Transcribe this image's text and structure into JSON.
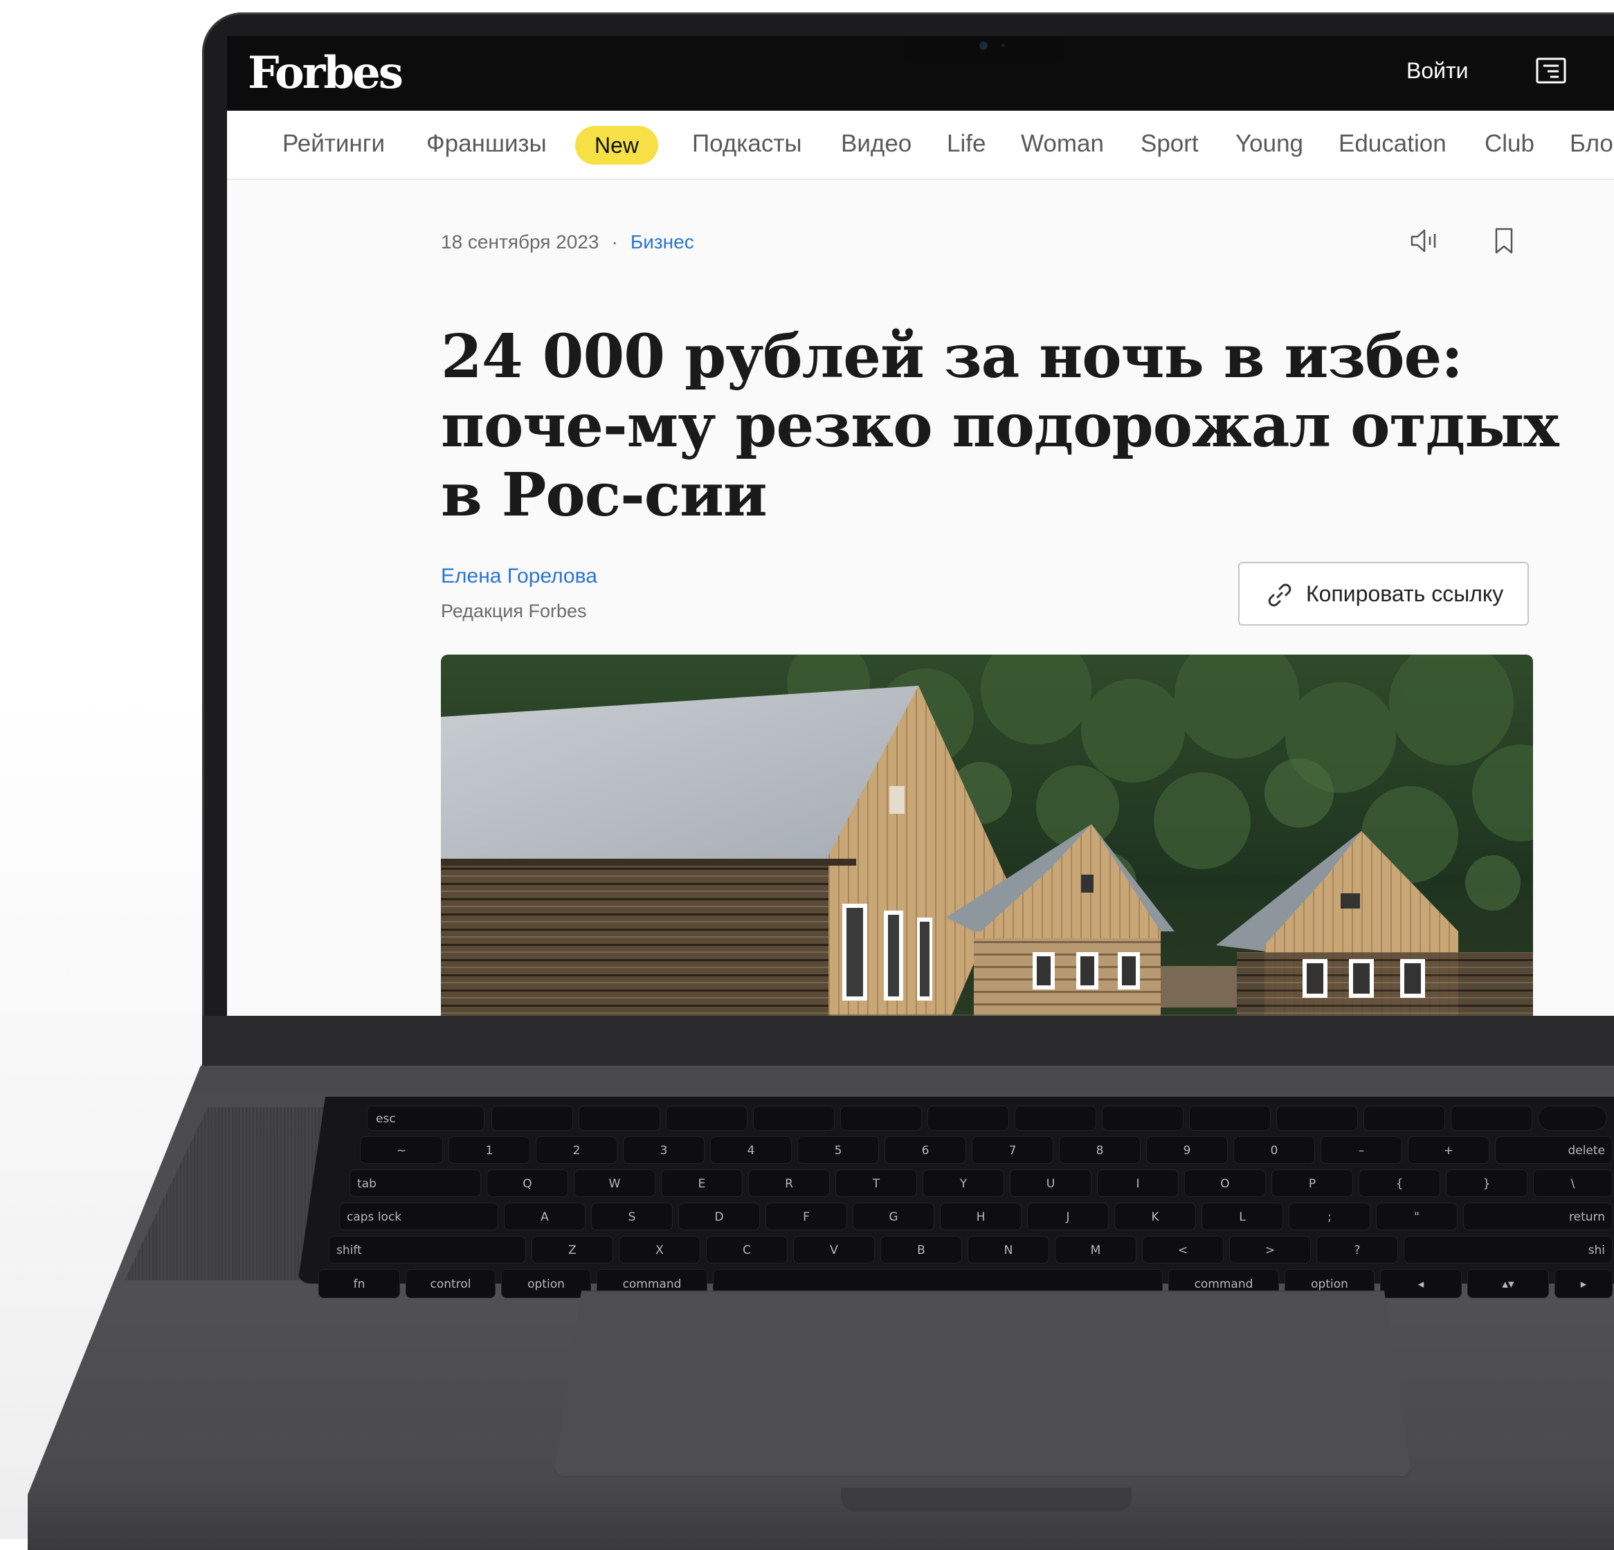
{
  "site": {
    "logo": "Forbes",
    "login_label": "Войти",
    "menu_icon": "menu-icon"
  },
  "nav": {
    "items": [
      {
        "label": "Рейтинги"
      },
      {
        "label": "Франшизы"
      },
      {
        "label": "New",
        "badge": true,
        "badge_color": "#f6e046"
      },
      {
        "label": "Подкасты"
      },
      {
        "label": "Видео"
      },
      {
        "label": "Life"
      },
      {
        "label": "Woman"
      },
      {
        "label": "Sport"
      },
      {
        "label": "Young"
      },
      {
        "label": "Education"
      },
      {
        "label": "Club"
      },
      {
        "label": "Бло"
      }
    ]
  },
  "article": {
    "date": "18 сентября 2023",
    "separator": "·",
    "category": "Бизнес",
    "headline": "24 000 рублей за ночь в избе: поче-му резко подорожал отдых в Рос-сии",
    "author": "Елена Горелова",
    "author_role": "Редакция Forbes",
    "copy_link_label": "Копировать ссылку",
    "listen_icon": "speaker-icon",
    "bookmark_icon": "bookmark-icon",
    "link_icon": "link-icon",
    "photo_alt": "wooden log houses with metal roofs in front of a forest"
  },
  "keyboard": {
    "row_fn": [
      "esc",
      "",
      "",
      "",
      "",
      "",
      "",
      "",
      "",
      "",
      "",
      "",
      ""
    ],
    "row_num": [
      "~",
      "1",
      "2",
      "3",
      "4",
      "5",
      "6",
      "7",
      "8",
      "9",
      "0",
      "–",
      "+",
      "delete"
    ],
    "row_q": [
      "tab",
      "Q",
      "W",
      "E",
      "R",
      "T",
      "Y",
      "U",
      "I",
      "O",
      "P",
      "{",
      "}",
      "\\"
    ],
    "row_a": [
      "caps lock",
      "A",
      "S",
      "D",
      "F",
      "G",
      "H",
      "J",
      "K",
      "L",
      ";",
      "\"",
      "return"
    ],
    "row_z": [
      "shift",
      "Z",
      "X",
      "C",
      "V",
      "B",
      "N",
      "M",
      "<",
      ">",
      "?",
      "shi"
    ],
    "row_bottom": [
      "fn",
      "control",
      "option",
      "command",
      "",
      "command",
      "option",
      "◂",
      "▴▾",
      "▸"
    ]
  },
  "colors": {
    "accent_link": "#2a74d4",
    "header_bg": "#0c0c0c",
    "new_badge": "#f6e046"
  }
}
